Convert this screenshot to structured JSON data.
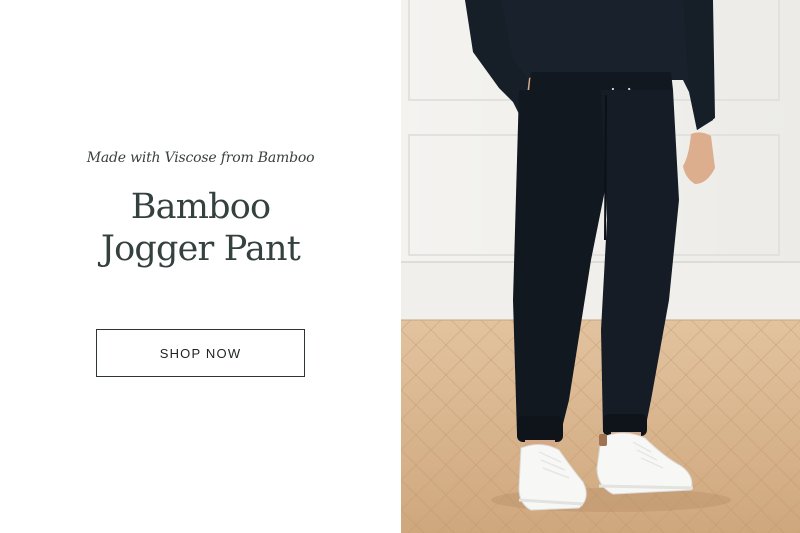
{
  "promo": {
    "subtitle": "Made with Viscose from Bamboo",
    "title_line1": "Bamboo",
    "title_line2": "Jogger Pant",
    "cta_label": "SHOP NOW"
  },
  "colors": {
    "heading": "#34413f",
    "button_border": "#2f3533",
    "garment": "#141a22",
    "floor": "#d8b58e"
  },
  "photo": {
    "subject": "model wearing dark bamboo jogger pants and white sneakers on herringbone wood floor"
  }
}
